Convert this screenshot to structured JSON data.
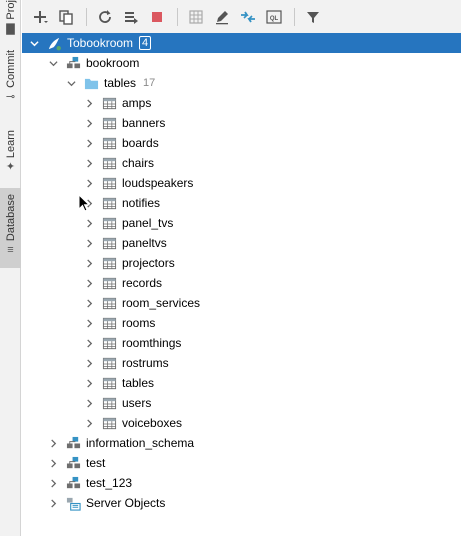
{
  "side_tabs": [
    {
      "label": "Proj",
      "icon": "folder-icon"
    },
    {
      "label": "Commit",
      "icon": "commit-icon"
    },
    {
      "label": "Learn",
      "icon": "learn-icon"
    },
    {
      "label": "Database",
      "icon": "database-icon",
      "active": true
    }
  ],
  "toolbar": {
    "buttons": [
      {
        "name": "add-button",
        "icon": "plus-icon"
      },
      {
        "name": "duplicate-button",
        "icon": "copy-icon"
      },
      {
        "name": "refresh-button",
        "icon": "refresh-icon"
      },
      {
        "name": "schema-button",
        "icon": "schema-icon"
      },
      {
        "name": "stop-button",
        "icon": "stop-icon"
      },
      {
        "name": "table-button",
        "icon": "table-icon"
      },
      {
        "name": "edit-button",
        "icon": "pencil-icon"
      },
      {
        "name": "compare-button",
        "icon": "compare-icon"
      },
      {
        "name": "console-button",
        "icon": "console-icon"
      },
      {
        "name": "filter-button",
        "icon": "filter-icon"
      }
    ],
    "ql_label": "QL"
  },
  "tree": {
    "datasource": {
      "label": "Tobookroom",
      "badge": "4"
    },
    "schema": {
      "label": "bookroom"
    },
    "tables_folder": {
      "label": "tables",
      "count": "17"
    },
    "tables": [
      "amps",
      "banners",
      "boards",
      "chairs",
      "loudspeakers",
      "notifies",
      "panel_tvs",
      "paneltvs",
      "projectors",
      "records",
      "room_services",
      "rooms",
      "roomthings",
      "rostrums",
      "tables",
      "users",
      "voiceboxes"
    ],
    "other_schemas": [
      "information_schema",
      "test",
      "test_123"
    ],
    "server_objects": {
      "label": "Server Objects"
    }
  },
  "colors": {
    "selection": "#2675bf",
    "accent_blue": "#3592c4",
    "stop_red": "#db5860"
  }
}
